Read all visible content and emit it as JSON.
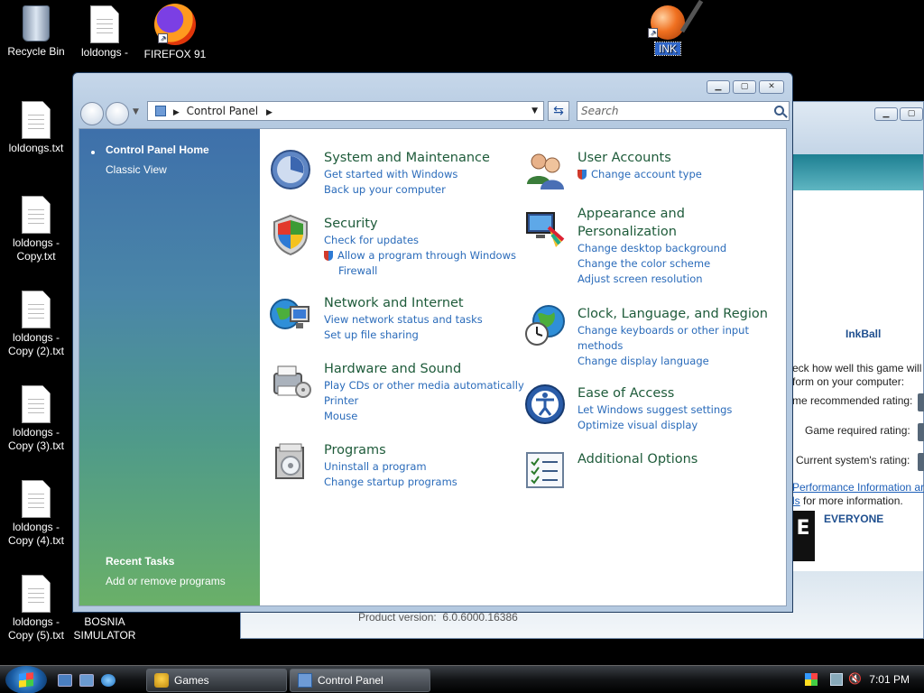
{
  "desktop": {
    "icons": [
      {
        "label": "Recycle Bin"
      },
      {
        "label": "loldongs - Copy (6).txt"
      },
      {
        "label": "FIREFOX 91"
      },
      {
        "label": "INK"
      },
      {
        "label": "loldongs.txt"
      },
      {
        "label": "loldongs - Copy.txt"
      },
      {
        "label": "loldongs - Copy (2).txt"
      },
      {
        "label": "loldongs - Copy (3).txt"
      },
      {
        "label": "loldongs - Copy (4).txt"
      },
      {
        "label": "loldongs - Copy (5).txt"
      },
      {
        "label": "BOSNIA SIMULATOR"
      }
    ]
  },
  "inkball": {
    "game_name": "InkBall",
    "check_text": "eck how well this game will",
    "check_text2": "form on your computer:",
    "recommended": "me recommended rating:",
    "required": "Game required rating:",
    "current": "Current system's rating:",
    "perf_link": "Performance Information ar",
    "perf_link2": "ls",
    "more_info": " for more information.",
    "rating": "EVERYONE",
    "esrb_letter": "E",
    "product_version_label": "Product version:",
    "product_version": "6.0.6000.16386"
  },
  "control_panel": {
    "address": "Control Panel",
    "search_placeholder": "Search",
    "sidebar": {
      "home": "Control Panel Home",
      "classic": "Classic View",
      "recent_title": "Recent Tasks",
      "recent_item": "Add or remove programs"
    },
    "categories_left": [
      {
        "title": "System and Maintenance",
        "links": [
          "Get started with Windows",
          "Back up your computer"
        ]
      },
      {
        "title": "Security",
        "links": [
          "Check for updates",
          "Allow a program through Windows",
          "Firewall"
        ]
      },
      {
        "title": "Network and Internet",
        "links": [
          "View network status and tasks",
          "Set up file sharing"
        ]
      },
      {
        "title": "Hardware and Sound",
        "links": [
          "Play CDs or other media automatically",
          "Printer",
          "Mouse"
        ]
      },
      {
        "title": "Programs",
        "links": [
          "Uninstall a program",
          "Change startup programs"
        ]
      }
    ],
    "categories_right": [
      {
        "title": "User Accounts",
        "links": [
          "Change account type"
        ]
      },
      {
        "title": "Appearance and",
        "title2": "Personalization",
        "links": [
          "Change desktop background",
          "Change the color scheme",
          "Adjust screen resolution"
        ]
      },
      {
        "title": "Clock, Language, and Region",
        "links": [
          "Change keyboards or other input",
          "methods",
          "Change display language"
        ]
      },
      {
        "title": "Ease of Access",
        "links": [
          "Let Windows suggest settings",
          "Optimize visual display"
        ]
      },
      {
        "title": "Additional Options",
        "links": []
      }
    ]
  },
  "taskbar": {
    "buttons": [
      {
        "label": "Games"
      },
      {
        "label": "Control Panel"
      }
    ],
    "clock": "7:01 PM"
  }
}
